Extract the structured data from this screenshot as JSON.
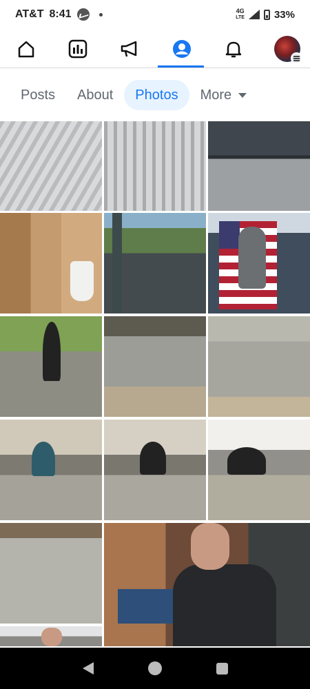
{
  "status_bar": {
    "carrier": "AT&T",
    "time": "8:41",
    "network_top": "4G",
    "network_bottom": "LTE",
    "battery": "33%",
    "battery_level": 0.33
  },
  "top_nav": {
    "items": [
      {
        "icon": "home-icon"
      },
      {
        "icon": "dashboard-icon"
      },
      {
        "icon": "megaphone-icon"
      },
      {
        "icon": "profile-icon",
        "active": true
      },
      {
        "icon": "bell-icon"
      },
      {
        "icon": "avatar-menu"
      }
    ],
    "accent": "#1877f2"
  },
  "tabs": [
    {
      "label": "Posts"
    },
    {
      "label": "About"
    },
    {
      "label": "Photos",
      "active": true
    },
    {
      "label": "More"
    }
  ],
  "photos": [
    {
      "style": "p-roof1"
    },
    {
      "style": "p-roof2"
    },
    {
      "style": "p-roof3"
    },
    {
      "style": "p-bath"
    },
    {
      "style": "p-slab1"
    },
    {
      "style": "p-flag"
    },
    {
      "style": "p-man"
    },
    {
      "style": "p-conc1"
    },
    {
      "style": "p-conc2"
    },
    {
      "style": "p-work1"
    },
    {
      "style": "p-work2"
    },
    {
      "style": "p-work3"
    },
    {
      "style": "p-garage"
    },
    {
      "style": "p-event"
    },
    {
      "style": "p-edge"
    }
  ],
  "colors": {
    "tab_active_bg": "#e7f3ff",
    "tab_active_text": "#1877f2",
    "tab_text": "#606770"
  }
}
